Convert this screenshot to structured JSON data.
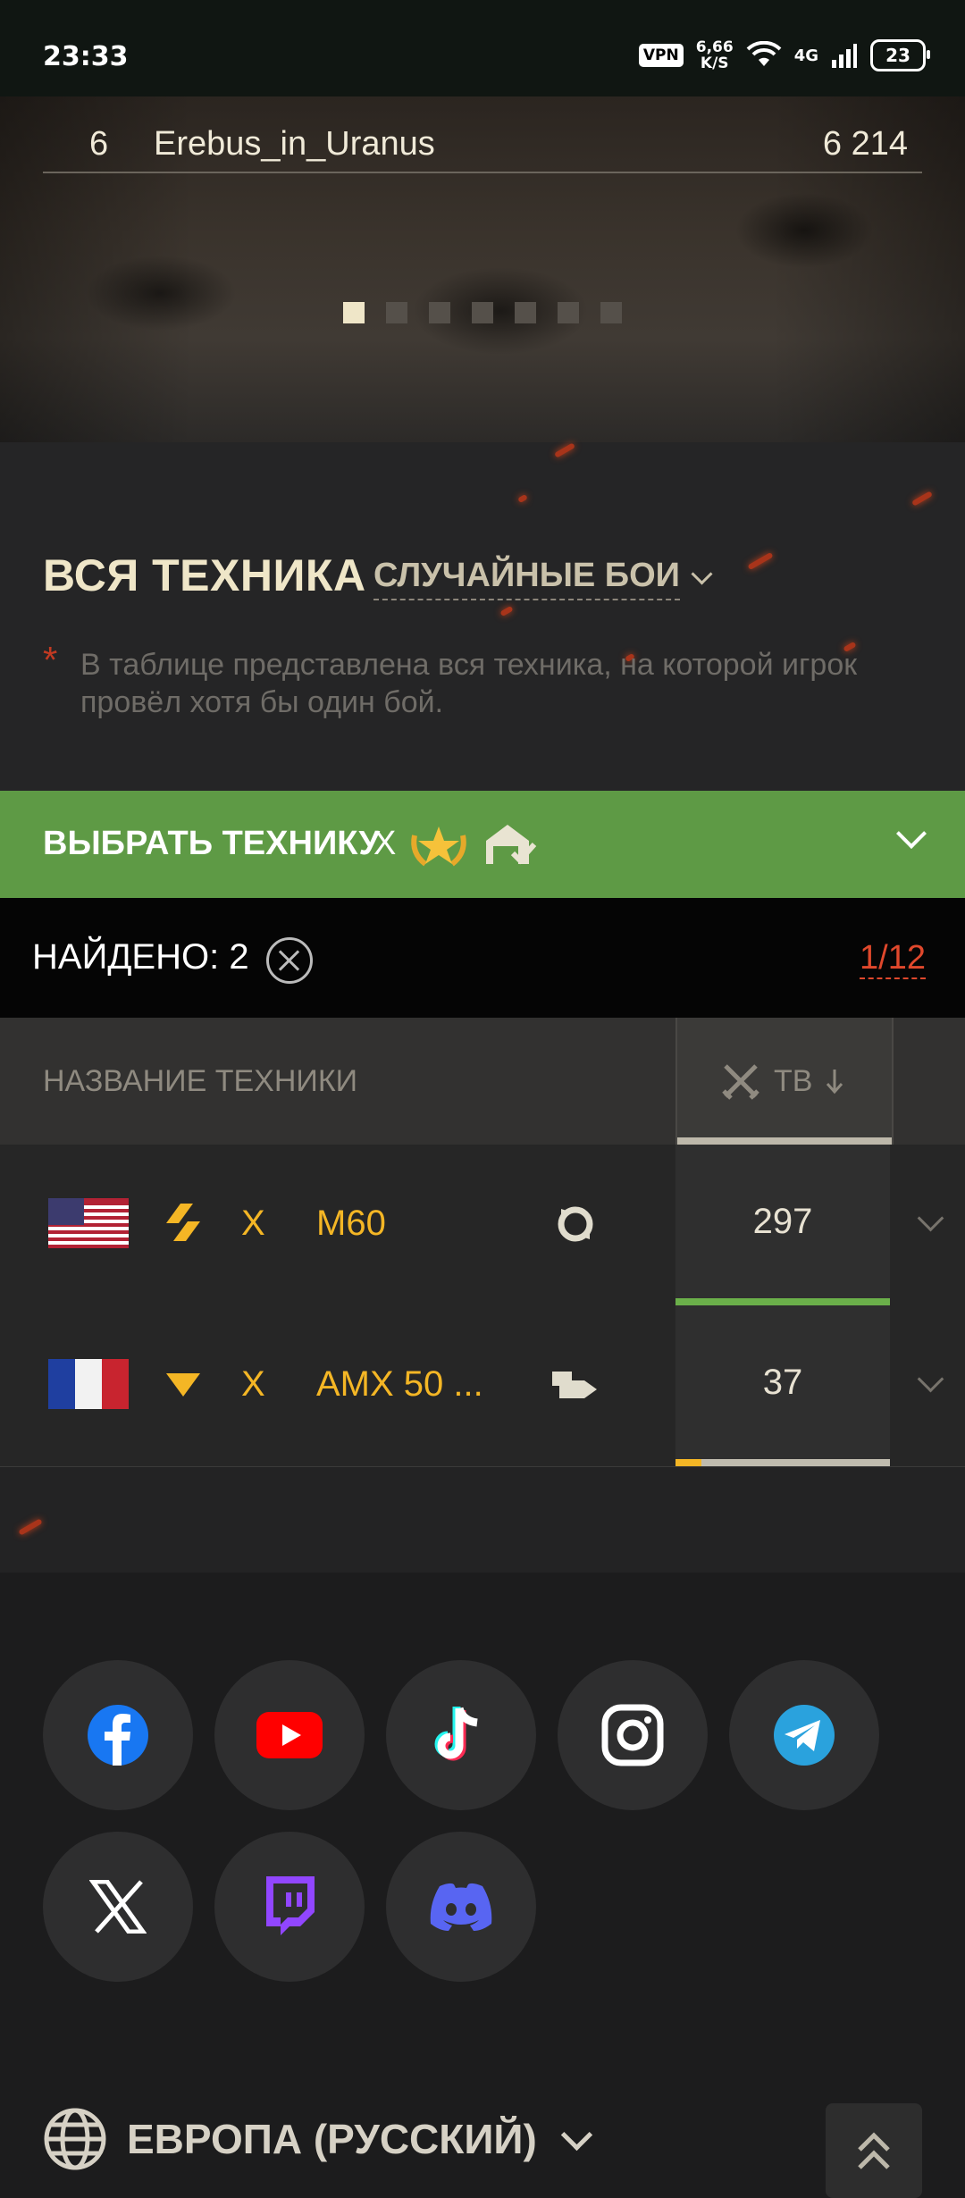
{
  "status_bar": {
    "time": "23:33",
    "vpn": "VPN",
    "speed_value": "6,66",
    "speed_unit": "K/S",
    "network": "4G",
    "battery": "23"
  },
  "leaderboard_row": {
    "rank": "6",
    "name": "Erebus_in_Uranus",
    "score": "6 214"
  },
  "carousel": {
    "pages": 7,
    "active": 1
  },
  "section": {
    "title": "ВСЯ ТЕХНИКА",
    "mode": "СЛУЧАЙНЫЕ БОИ",
    "note_marker": "*",
    "note": "В таблице представлена вся техника, на которой игрок провёл хотя бы один бой."
  },
  "filter": {
    "label": "ВЫБРАТЬ ТЕХНИКУ",
    "tier": "X"
  },
  "results": {
    "found": "НАЙДЕНО: 2",
    "page": "1/12"
  },
  "table": {
    "col_name": "НАЗВАНИЕ ТЕХНИКИ",
    "col_stat": "ТВ",
    "rows": [
      {
        "flag": "usa-flag",
        "type": "medium-tank-icon",
        "tier": "X",
        "name": "M60",
        "role": "versatile-role-icon",
        "value": "297",
        "bar_fraction": 1.0,
        "bar_color": "#6bb04a"
      },
      {
        "flag": "france-flag",
        "type": "tank-destroyer-icon",
        "tier": "X",
        "name": "AMX 50 ...",
        "role": "sniper-role-icon",
        "value": "37",
        "bar_fraction": 0.12,
        "bar_color": "#f4b625"
      }
    ]
  },
  "social": [
    "facebook-icon",
    "youtube-icon",
    "tiktok-icon",
    "instagram-icon",
    "telegram-icon",
    "x-icon",
    "twitch-icon",
    "discord-icon"
  ],
  "footer": {
    "region": "ЕВРОПА (РУССКИЙ)"
  }
}
